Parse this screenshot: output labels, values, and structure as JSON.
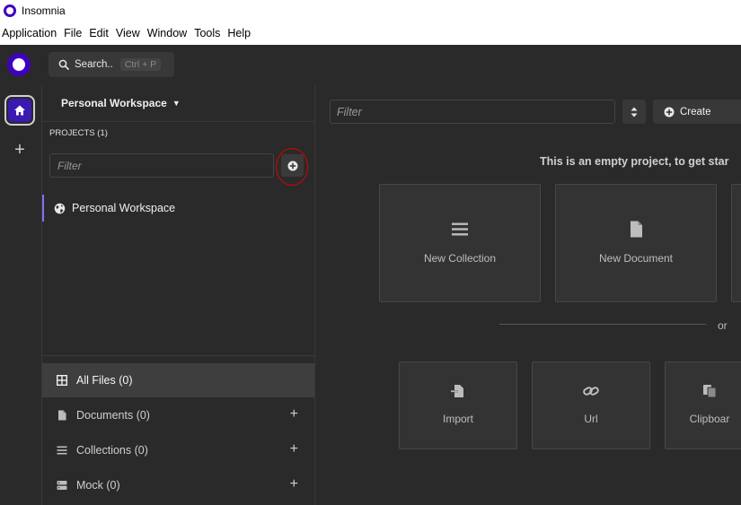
{
  "window": {
    "title": "Insomnia"
  },
  "menu": [
    "Application",
    "File",
    "Edit",
    "View",
    "Window",
    "Tools",
    "Help"
  ],
  "header": {
    "search_label": "Search..",
    "search_shortcut": "Ctrl + P"
  },
  "sidebar": {
    "workspace_title": "Personal Workspace",
    "projects_label": "PROJECTS (1)",
    "filter_placeholder": "Filter",
    "projects": [
      {
        "label": "Personal Workspace",
        "icon": "globe-icon"
      }
    ],
    "nav": [
      {
        "label": "All Files (0)",
        "icon": "grid-icon",
        "active": true
      },
      {
        "label": "Documents (0)",
        "icon": "document-icon"
      },
      {
        "label": "Collections (0)",
        "icon": "list-icon"
      },
      {
        "label": "Mock (0)",
        "icon": "server-icon"
      }
    ]
  },
  "main": {
    "filter_placeholder": "Filter",
    "create_label": "Create",
    "empty_message": "This is an empty project, to get star",
    "cards": [
      {
        "label": "New Collection",
        "icon": "list-icon"
      },
      {
        "label": "New Document",
        "icon": "document-icon"
      }
    ],
    "or_label": "or",
    "import_cards": [
      {
        "label": "Import",
        "icon": "import-icon"
      },
      {
        "label": "Url",
        "icon": "link-icon"
      },
      {
        "label": "Clipboar",
        "icon": "clipboard-icon"
      }
    ]
  },
  "colors": {
    "accent": "#4000bf",
    "background": "#2a2a2a",
    "annotation": "#e00000"
  }
}
